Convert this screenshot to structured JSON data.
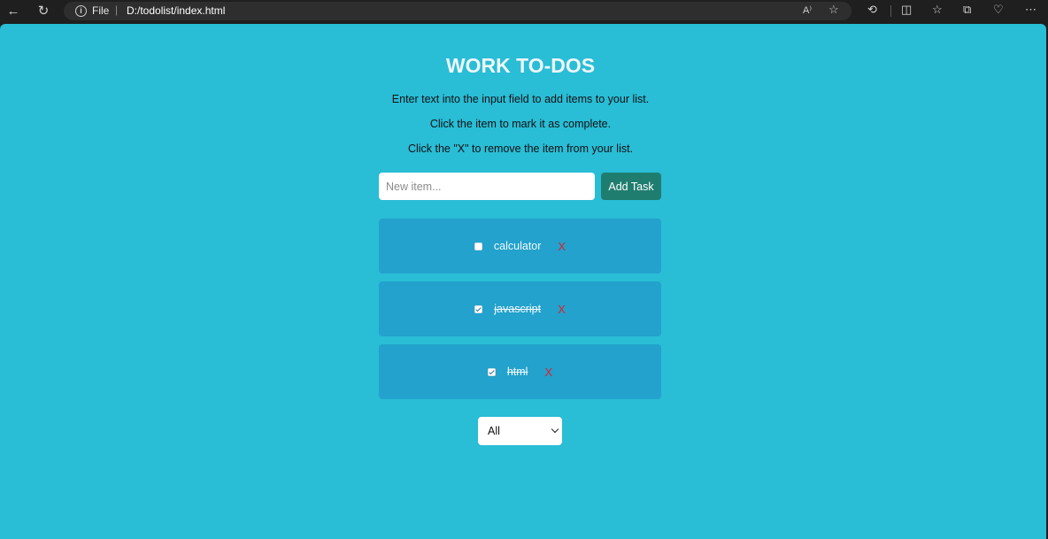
{
  "browser": {
    "url_scheme": "File",
    "url_separator": "|",
    "url_path": "D:/todolist/index.html",
    "icons": [
      "back-icon",
      "refresh-icon",
      "info-icon",
      "read-aloud-icon",
      "favorite-star-icon",
      "extensions-icon",
      "split-screen-icon",
      "favorites-icon",
      "collections-icon",
      "browser-essentials-icon",
      "more-icon"
    ]
  },
  "page": {
    "title": "WORK TO-DOS",
    "instructions": [
      "Enter text into the input field to add items to your list.",
      "Click the item to mark it as complete.",
      "Click the \"X\" to remove the item from your list."
    ],
    "input_placeholder": "New item...",
    "add_button_label": "Add Task",
    "tasks": [
      {
        "label": "calculator",
        "completed": false,
        "delete_label": "X"
      },
      {
        "label": "javascript",
        "completed": true,
        "delete_label": "X"
      },
      {
        "label": "html",
        "completed": true,
        "delete_label": "X"
      }
    ],
    "filter_selected": "All"
  },
  "colors": {
    "background": "#29bdd6",
    "task_background": "#22a2cc",
    "add_button": "#1f7d6f",
    "delete_x": "#e0202a"
  }
}
